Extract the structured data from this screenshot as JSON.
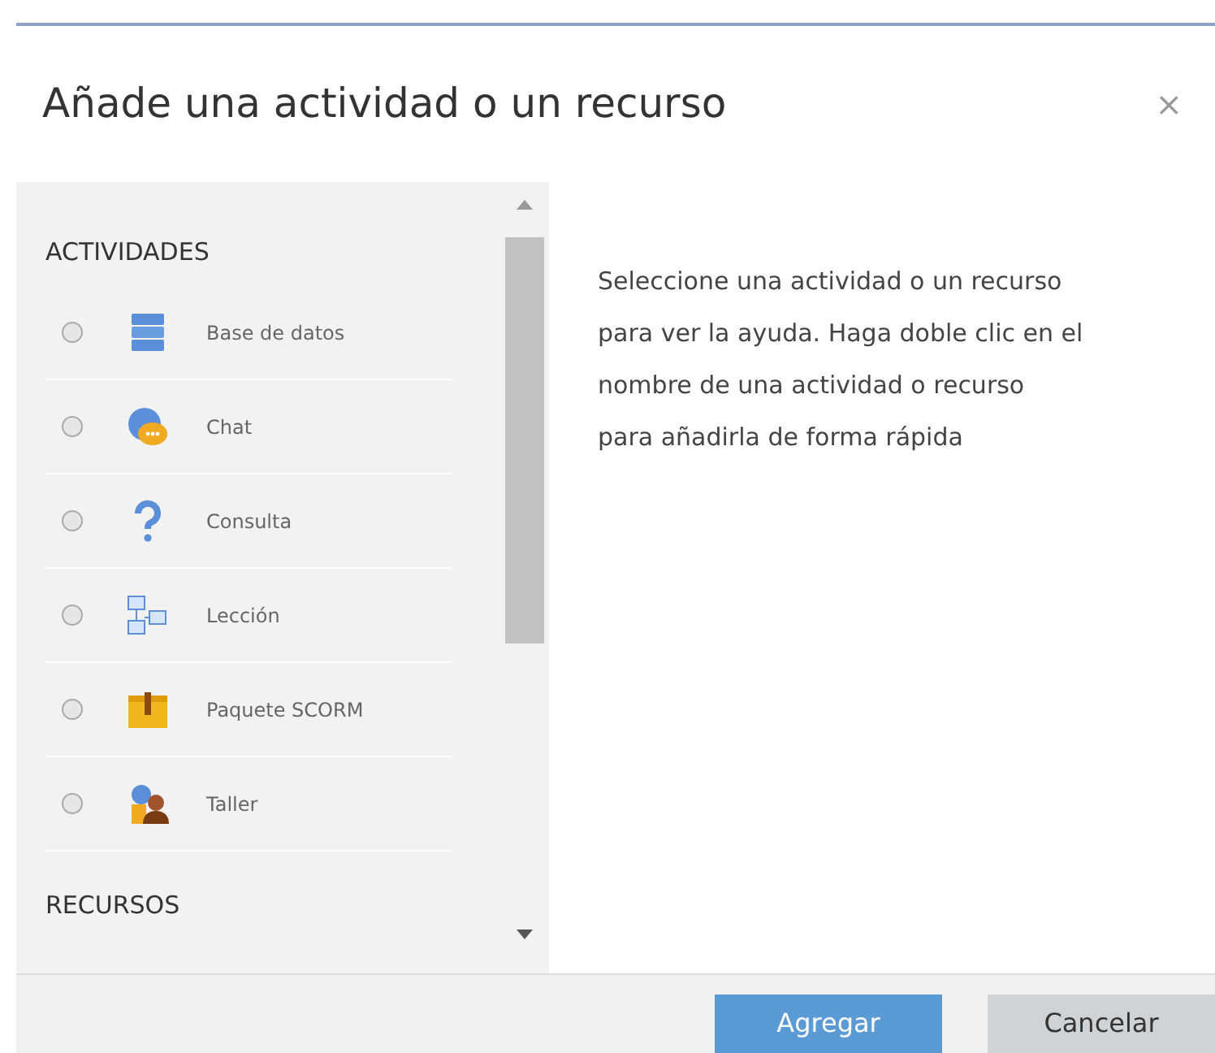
{
  "dialog": {
    "title": "Añade una actividad o un recurso",
    "close": "×"
  },
  "sections": [
    {
      "heading": "ACTIVIDADES",
      "items": [
        {
          "label": "Base de datos",
          "kind": "database",
          "selected": false
        },
        {
          "label": "Chat",
          "kind": "chat",
          "selected": false
        },
        {
          "label": "Consulta",
          "kind": "question",
          "selected": false
        },
        {
          "label": "Lección",
          "kind": "lesson",
          "selected": false
        },
        {
          "label": "Paquete SCORM",
          "kind": "package",
          "selected": false
        },
        {
          "label": "Taller",
          "kind": "workshop",
          "selected": false
        }
      ]
    },
    {
      "heading": "RECURSOS"
    }
  ],
  "help_text": "Seleccione una actividad o un recurso para ver la ayuda. Haga doble clic en el nombre de una actividad o recurso para añadirla de forma rápida",
  "buttons": [
    {
      "label": "Agregar",
      "kind": "primary"
    },
    {
      "label": "Cancelar",
      "kind": "secondary"
    }
  ]
}
